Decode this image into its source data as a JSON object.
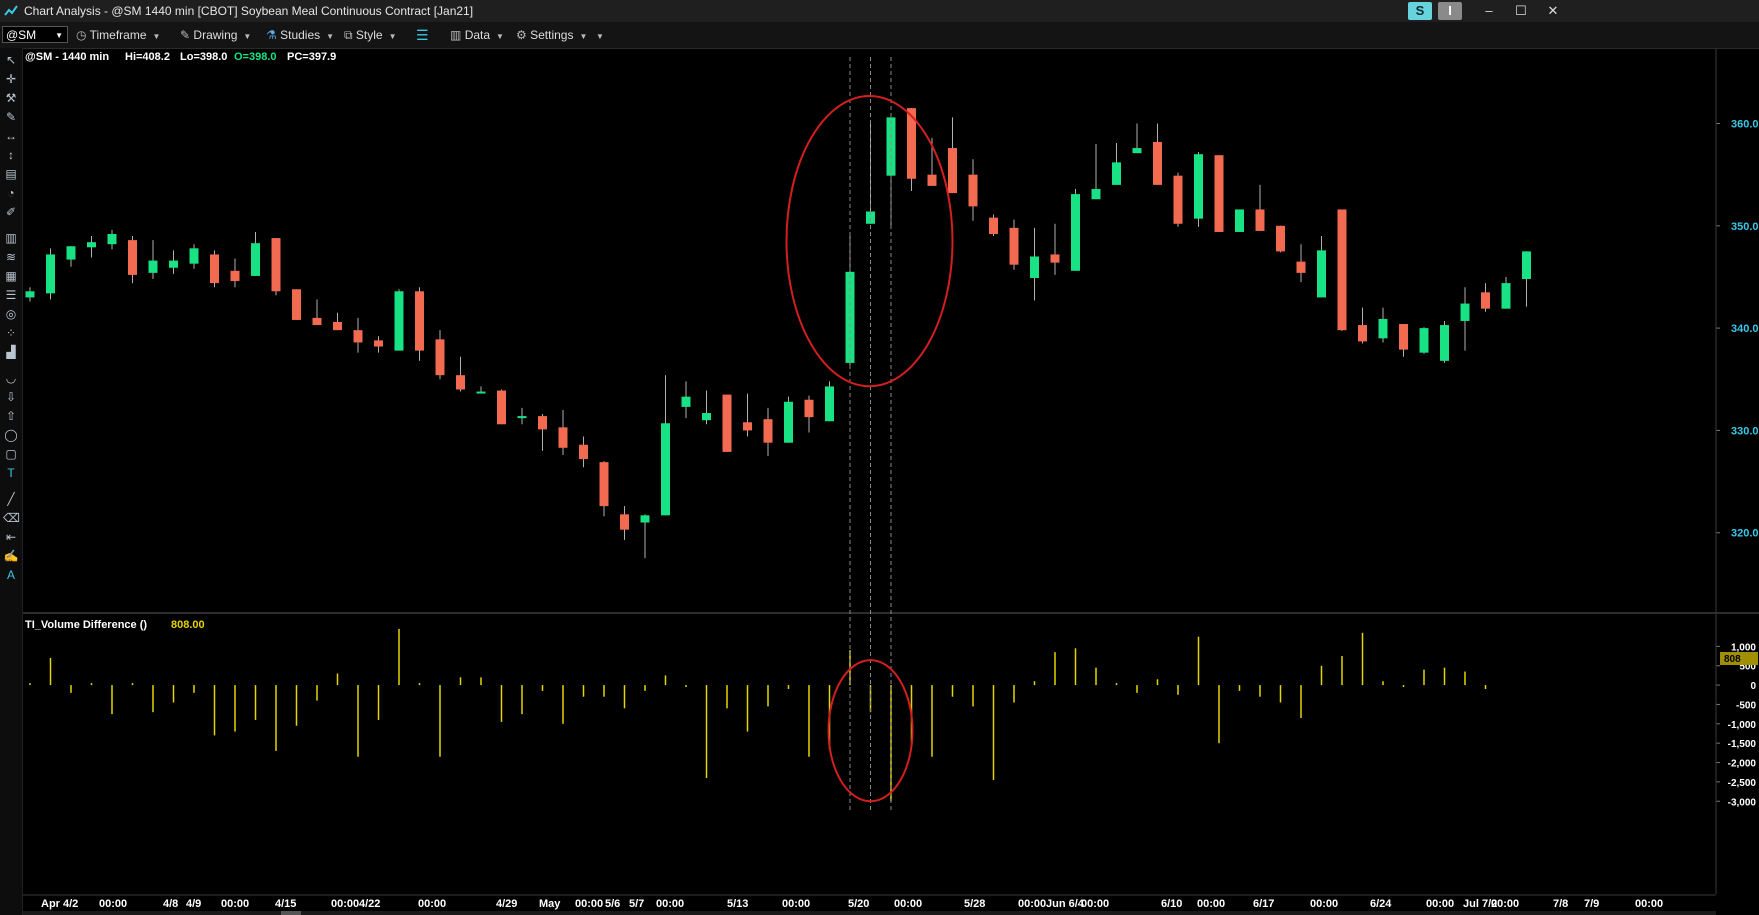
{
  "window": {
    "title": "Chart Analysis - @SM 1440 min [CBOT] Soybean Meal Continuous Contract [Jan21]",
    "badges": [
      "S",
      "I"
    ],
    "controls": [
      "–",
      "☐",
      "✕"
    ]
  },
  "toolbar": {
    "symbol": "@SM",
    "items": [
      "Timeframe",
      "Drawing",
      "Studies",
      "Style",
      "Data",
      "Settings"
    ]
  },
  "price_header": {
    "symbol_interval": "@SM - 1440 min",
    "hi": "Hi=408.2",
    "lo": "Lo=398.0",
    "open": "O=398.0",
    "prev_close": "PC=397.9"
  },
  "indicator_header": {
    "name": "TI_Volume Difference ()",
    "value": "808.00",
    "value_badge": "808"
  },
  "colors": {
    "up": "#18e283",
    "down": "#f26a50",
    "volume": "#e5d400",
    "axis_price": "#3ac8e8",
    "annotation": "#d21f1f"
  },
  "tools": [
    "select-arrow-icon",
    "crosshair-icon",
    "wrench-icon",
    "pencil-icon",
    "horizontal-arrow-icon",
    "vertical-arrow-icon",
    "channel-icon",
    "circle-arc-icon",
    "brush-icon",
    "bars-icon",
    "zigzag-icon",
    "grid-icon",
    "horizontal-lines-icon",
    "spiral-icon",
    "dots-icon",
    "bar-steps-icon",
    "curve-icon",
    "arrow-down-icon",
    "arrow-up-icon",
    "ellipse-icon",
    "rectangle-icon",
    "text-icon",
    "line-icon",
    "eraser-icon",
    "left-arrow-icon",
    "magic-pencil-icon",
    "label-icon"
  ],
  "chart_data": [
    {
      "type": "candlestick",
      "title": "@SM - 1440 min",
      "ylim": [
        314.5,
        366.5
      ],
      "y_ticks": [
        "360.0",
        "350.0",
        "340.0",
        "330.0",
        "320.0"
      ],
      "x_labels": [
        "Apr 4/2",
        "00:00",
        "4/8",
        "4/9",
        "00:00",
        "4/15",
        "00:00",
        "4/22",
        "00:00",
        "4/29",
        "May",
        "00:00",
        "5/6",
        "5/7",
        "00:00",
        "5/13",
        "00:00",
        "5/20",
        "00:00",
        "5/28",
        "00:00",
        "Jun 6/4",
        "00:00",
        "6/10",
        "00:00",
        "6/17",
        "00:00",
        "6/24",
        "00:00",
        "Jul 7/2",
        "00:00",
        "7/8",
        "7/9",
        "00:00"
      ],
      "ohlc": [
        [
          343.0,
          344.0,
          342.6,
          343.6
        ],
        [
          343.4,
          347.8,
          342.8,
          347.2
        ],
        [
          346.7,
          348.0,
          346.0,
          348.0
        ],
        [
          347.9,
          349.0,
          346.9,
          348.4
        ],
        [
          348.2,
          349.6,
          347.7,
          349.2
        ],
        [
          348.6,
          349.0,
          344.4,
          345.2
        ],
        [
          345.4,
          348.6,
          344.8,
          346.6
        ],
        [
          345.9,
          347.6,
          345.3,
          346.6
        ],
        [
          346.3,
          348.2,
          345.8,
          347.8
        ],
        [
          347.2,
          347.6,
          344.0,
          344.4
        ],
        [
          345.6,
          346.8,
          344.0,
          344.6
        ],
        [
          345.1,
          349.4,
          345.1,
          348.3
        ],
        [
          348.8,
          348.8,
          343.2,
          343.6
        ],
        [
          343.8,
          343.8,
          340.8,
          340.8
        ],
        [
          341.0,
          342.8,
          340.8,
          340.3
        ],
        [
          340.6,
          341.5,
          339.8,
          339.8
        ],
        [
          339.8,
          341.0,
          337.6,
          338.6
        ],
        [
          338.8,
          339.2,
          337.6,
          338.2
        ],
        [
          337.8,
          343.8,
          337.8,
          343.6
        ],
        [
          343.6,
          344.0,
          336.8,
          337.8
        ],
        [
          338.9,
          339.8,
          335.0,
          335.4
        ],
        [
          335.4,
          337.2,
          333.8,
          334.0
        ],
        [
          333.8,
          334.3,
          333.7,
          333.8
        ],
        [
          333.9,
          334.0,
          330.8,
          330.6
        ],
        [
          331.2,
          332.2,
          330.6,
          331.4
        ],
        [
          331.4,
          331.6,
          328.0,
          330.1
        ],
        [
          330.3,
          332.0,
          327.6,
          328.3
        ],
        [
          328.6,
          329.4,
          326.4,
          327.2
        ],
        [
          326.9,
          327.0,
          321.6,
          322.6
        ],
        [
          321.8,
          322.6,
          319.3,
          320.3
        ],
        [
          321.0,
          321.8,
          317.5,
          321.7
        ],
        [
          321.7,
          335.4,
          321.7,
          330.7
        ],
        [
          332.3,
          334.8,
          331.2,
          333.3
        ],
        [
          331.0,
          333.9,
          330.6,
          331.7
        ],
        [
          333.5,
          333.2,
          327.9,
          327.9
        ],
        [
          330.8,
          333.6,
          329.4,
          330.0
        ],
        [
          331.1,
          332.2,
          327.5,
          328.8
        ],
        [
          328.8,
          333.3,
          328.8,
          332.8
        ],
        [
          333.0,
          333.4,
          329.8,
          331.3
        ],
        [
          330.9,
          334.8,
          330.9,
          334.3
        ],
        [
          336.6,
          349.2,
          336.4,
          345.5
        ],
        [
          350.2,
          360.2,
          350.2,
          351.4
        ],
        [
          354.9,
          360.0,
          350.0,
          360.6
        ],
        [
          361.5,
          361.5,
          353.4,
          354.6
        ],
        [
          355.0,
          358.6,
          353.9,
          353.9
        ],
        [
          357.6,
          360.6,
          353.5,
          353.2
        ],
        [
          355.0,
          356.5,
          350.5,
          351.9
        ],
        [
          350.8,
          351.1,
          349.0,
          349.2
        ],
        [
          349.8,
          350.6,
          345.7,
          346.2
        ],
        [
          344.9,
          349.8,
          342.7,
          347.0
        ],
        [
          347.2,
          350.2,
          345.2,
          346.4
        ],
        [
          345.6,
          353.6,
          346.0,
          353.1
        ],
        [
          352.6,
          358.0,
          353.2,
          353.6
        ],
        [
          354.0,
          358.1,
          355.0,
          356.2
        ],
        [
          357.1,
          360.0,
          357.2,
          357.6
        ],
        [
          358.2,
          360.0,
          354.7,
          354.0
        ],
        [
          354.9,
          355.2,
          349.9,
          350.2
        ],
        [
          350.7,
          357.2,
          349.9,
          357.0
        ],
        [
          356.9,
          356.6,
          350.1,
          349.4
        ],
        [
          349.4,
          350.1,
          350.0,
          351.6
        ],
        [
          351.6,
          354.0,
          349.9,
          349.5
        ],
        [
          350.0,
          350.0,
          347.4,
          347.5
        ],
        [
          346.5,
          348.2,
          344.5,
          345.4
        ],
        [
          343.0,
          349.0,
          345.5,
          347.6
        ],
        [
          351.6,
          351.6,
          339.7,
          339.8
        ],
        [
          340.3,
          342.0,
          338.5,
          338.7
        ],
        [
          339.0,
          342.0,
          338.6,
          340.9
        ],
        [
          340.4,
          340.4,
          337.2,
          337.9
        ],
        [
          337.6,
          340.1,
          337.5,
          340.0
        ],
        [
          336.8,
          340.7,
          336.6,
          340.3
        ],
        [
          340.7,
          344.0,
          337.8,
          342.4
        ],
        [
          343.5,
          344.4,
          341.6,
          341.9
        ],
        [
          341.9,
          345.0,
          342.4,
          344.4
        ],
        [
          344.8,
          347.5,
          342.1,
          347.5
        ]
      ]
    },
    {
      "type": "bar",
      "title": "TI_Volume Difference ()",
      "ylim": [
        -3200,
        1500
      ],
      "y_ticks": [
        "1,000",
        "500",
        "0",
        "-500",
        "-1,000",
        "-1,500",
        "-2,000",
        "-2,500",
        "-3,000"
      ],
      "values": [
        50,
        700,
        -200,
        50,
        -750,
        50,
        -700,
        -450,
        -200,
        -1300,
        -1200,
        -900,
        -1700,
        -1050,
        -400,
        300,
        -1850,
        -900,
        1450,
        50,
        -1850,
        200,
        200,
        -950,
        -750,
        -150,
        -1000,
        -300,
        -300,
        -600,
        -150,
        250,
        -50,
        -2400,
        -600,
        -1200,
        -550,
        -100,
        -1850,
        -1650,
        900,
        -700,
        -3000,
        -1500,
        -1850,
        -300,
        -550,
        -2450,
        -450,
        100,
        850,
        950,
        450,
        50,
        -200,
        150,
        -250,
        1250,
        -1500,
        -150,
        -300,
        -450,
        -850,
        500,
        750,
        1350,
        100,
        -50,
        400,
        450,
        350,
        -100
      ]
    }
  ],
  "annotations": [
    "price-spike-ellipse",
    "volume-spike-ellipse"
  ]
}
